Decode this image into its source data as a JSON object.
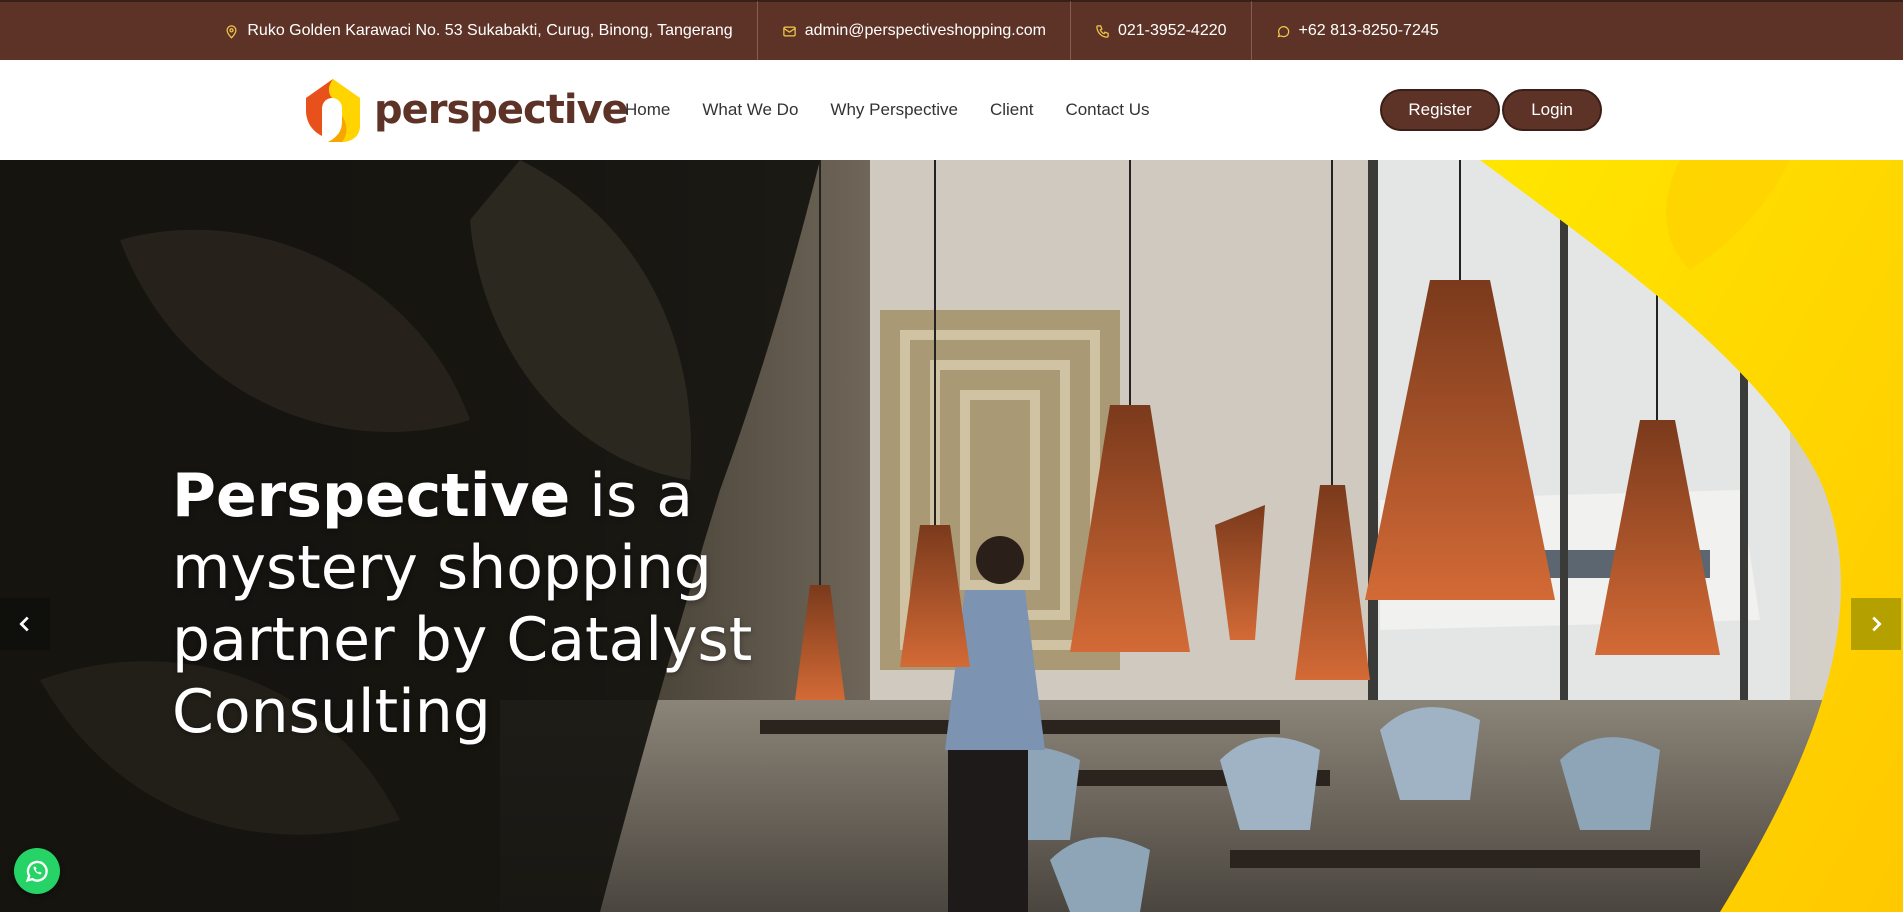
{
  "contact": {
    "address": "Ruko Golden Karawaci No. 53 Sukabakti, Curug, Binong, Tangerang",
    "email": "admin@perspectiveshopping.com",
    "phone": "021-3952-4220",
    "whatsapp": "+62 813-8250-7245"
  },
  "logo": {
    "text": "perspective"
  },
  "nav": {
    "items": [
      "Home",
      "What We Do",
      "Why Perspective",
      "Client",
      "Contact Us"
    ]
  },
  "auth": {
    "register": "Register",
    "login": "Login"
  },
  "hero": {
    "title_bold": "Perspective",
    "title_rest": " is a mystery shopping partner by Catalyst Consulting"
  },
  "icons": {
    "address": "map-pin-icon",
    "email": "mail-icon",
    "phone": "phone-icon",
    "whatsapp": "whatsapp-icon",
    "prev": "chevron-left-icon",
    "next": "chevron-right-icon"
  },
  "colors": {
    "brand_brown": "#5e3327",
    "brand_yellow": "#ffd400",
    "accent_orange": "#e8501c",
    "whatsapp_green": "#25d366",
    "slider_next": "#b4a100"
  }
}
